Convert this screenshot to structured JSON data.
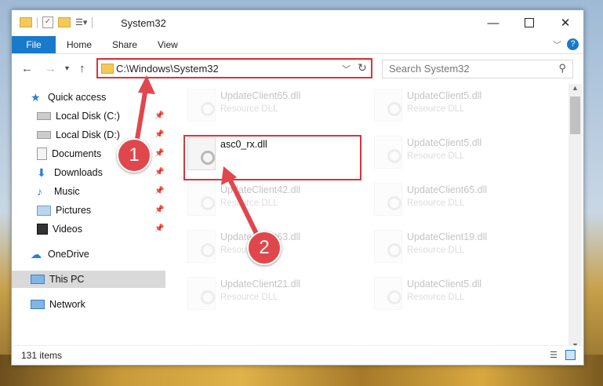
{
  "window": {
    "title": "System32"
  },
  "ribbon": {
    "file": "File",
    "tabs": [
      "Home",
      "Share",
      "View"
    ]
  },
  "address": {
    "path": "C:\\Windows\\System32"
  },
  "search": {
    "placeholder": "Search System32"
  },
  "sidebar": {
    "items": [
      {
        "label": "Quick access",
        "icon": "star-icon"
      },
      {
        "label": "Local Disk (C:)",
        "icon": "drive-icon",
        "pinned": true
      },
      {
        "label": "Local Disk (D:)",
        "icon": "drive-icon",
        "pinned": true
      },
      {
        "label": "Documents",
        "icon": "documents-icon",
        "pinned": true
      },
      {
        "label": "Downloads",
        "icon": "download-icon",
        "pinned": true
      },
      {
        "label": "Music",
        "icon": "music-icon",
        "pinned": true
      },
      {
        "label": "Pictures",
        "icon": "pictures-icon",
        "pinned": true
      },
      {
        "label": "Videos",
        "icon": "videos-icon",
        "pinned": true
      },
      {
        "label": "OneDrive",
        "icon": "cloud-icon"
      },
      {
        "label": "This PC",
        "icon": "computer-icon",
        "selected": true
      },
      {
        "label": "Network",
        "icon": "network-icon"
      }
    ]
  },
  "files": {
    "highlighted": {
      "name": "asc0_rx.dll"
    },
    "faded": [
      {
        "name": "UpdateClient65.dll",
        "type": "Resource DLL"
      },
      {
        "name": "UpdateClient5.dll",
        "type": "Resource DLL"
      },
      {
        "name": "UpdateClient5.dll",
        "type": "Resource DLL"
      },
      {
        "name": "UpdateClient42.dll",
        "type": "Resource DLL"
      },
      {
        "name": "UpdateClient65.dll",
        "type": "Resource DLL"
      },
      {
        "name": "UpdateClient63.dll",
        "type": "Resource DLL"
      },
      {
        "name": "UpdateClient19.dll",
        "type": "Resource DLL"
      },
      {
        "name": "UpdateClient21.dll",
        "type": "Resource DLL"
      },
      {
        "name": "UpdateClient5.dll",
        "type": "Resource DLL"
      }
    ]
  },
  "status": {
    "items": "131 items"
  },
  "markers": {
    "one": "1",
    "two": "2"
  },
  "colors": {
    "accent": "#1979ca",
    "highlight": "#d9343a",
    "marker": "#e0474c"
  }
}
